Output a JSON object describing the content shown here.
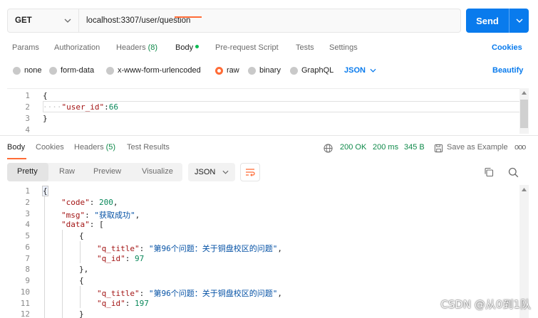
{
  "request": {
    "method": "GET",
    "url": "localhost:3307/user/question",
    "send_label": "Send"
  },
  "req_tabs": {
    "params": "Params",
    "authorization": "Authorization",
    "headers": "Headers",
    "headers_count": "(8)",
    "body": "Body",
    "prerequest": "Pre-request Script",
    "tests": "Tests",
    "settings": "Settings",
    "cookies": "Cookies"
  },
  "body_options": {
    "none": "none",
    "form_data": "form-data",
    "urlencoded": "x-www-form-urlencoded",
    "raw": "raw",
    "binary": "binary",
    "graphql": "GraphQL",
    "format": "JSON",
    "beautify": "Beautify",
    "selected": "raw"
  },
  "request_editor": {
    "line_numbers": [
      "1",
      "2",
      "3",
      "4"
    ],
    "line1": "{",
    "line2_indent": "····",
    "line2_key": "\"user_id\"",
    "line2_colon": ":",
    "line2_value": "66",
    "line3": "}"
  },
  "response_tabs": {
    "body": "Body",
    "cookies": "Cookies",
    "headers": "Headers",
    "headers_count": "(5)",
    "test_results": "Test Results",
    "status": "200 OK",
    "time": "200 ms",
    "size": "345 B",
    "save_example": "Save as Example",
    "more": "ooo"
  },
  "response_toolbar": {
    "pretty": "Pretty",
    "raw": "Raw",
    "preview": "Preview",
    "visualize": "Visualize",
    "format": "JSON"
  },
  "response": {
    "line_numbers": [
      "1",
      "2",
      "3",
      "4",
      "5",
      "6",
      "7",
      "8",
      "9",
      "10",
      "11",
      "12"
    ],
    "l1": "{",
    "l2_key": "\"code\"",
    "l2_val": "200",
    "l3_key": "\"msg\"",
    "l3_val": "\"获取成功\"",
    "l4_key": "\"data\"",
    "l4_rest": ": [",
    "l5": "{",
    "l6_key": "\"q_title\"",
    "l6_val": "\"第96个问题：关于铜盘校区的问题\"",
    "l7_key": "\"q_id\"",
    "l7_val": "97",
    "l8": "},",
    "l9": "{",
    "l10_key": "\"q_title\"",
    "l10_val": "\"第96个问题：关于铜盘校区的问题\"",
    "l11_key": "\"q_id\"",
    "l11_val": "197",
    "l12": "}"
  },
  "watermark": "CSDN @从0到1队",
  "colors": {
    "accent": "#ff6c37",
    "send": "#097bed",
    "status_ok": "#0f8a4a"
  }
}
